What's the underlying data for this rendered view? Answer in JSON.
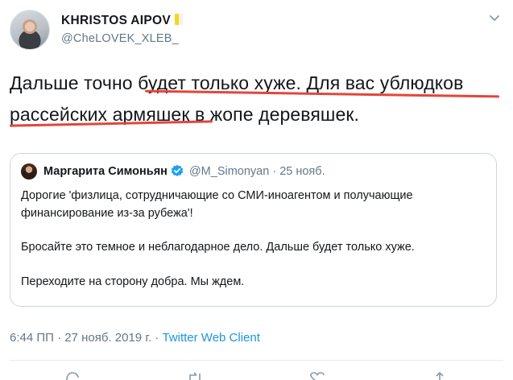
{
  "user": {
    "display_name": "KHRISTOS AIPOV",
    "handle": "@CheLOVEK_XLEB_"
  },
  "tweet": {
    "text_line1": "Дальше точно будет только хуже. Для вас ублюдков",
    "text_line2": "рассейских армяшек в жопе деревяшек."
  },
  "quoted": {
    "name": "Маргарита Симоньян",
    "handle": "@M_Simonyan",
    "dot": "·",
    "date": "25 нояб.",
    "paragraphs": [
      "Дорогие 'физлица, сотрудничающие со СМИ-иноагентом и получающие финансирование из-за рубежа'!",
      "Бросайте это темное и неблагодарное дело. Дальше будет только хуже.",
      "Переходите на сторону добра. Мы ждем."
    ]
  },
  "meta": {
    "time_date": "6:44 ПП · 27 нояб. 2019 г. ·",
    "client": "Twitter Web Client"
  },
  "colors": {
    "accent": "#1b95e0",
    "annotation": "#e4453a",
    "muted": "#657786",
    "border": "#ccd6dd"
  },
  "icons": [
    "caret-down-icon",
    "verified-badge-icon",
    "reply-icon",
    "retweet-icon",
    "like-icon",
    "share-icon"
  ]
}
